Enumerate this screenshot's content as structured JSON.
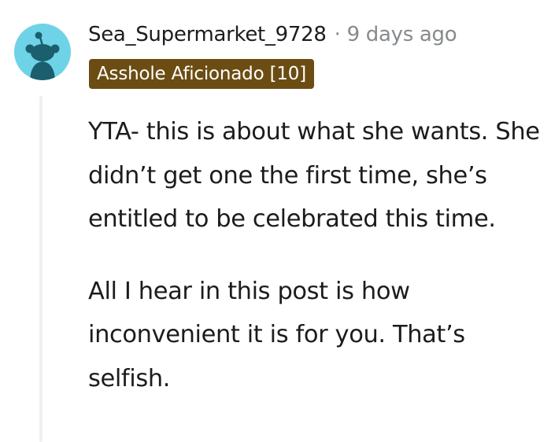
{
  "comment": {
    "username": "Sea_Supermarket_9728",
    "separator": "·",
    "timestamp": "9 days ago",
    "flair": "Asshole Aficionado [10]",
    "paragraphs": [
      "YTA- this is about what she wants. She didn’t get one the first time, she’s entitled to be celebrated this time.",
      "All I hear in this post is how inconvenient it is for you. That’s selfish."
    ]
  },
  "colors": {
    "avatar_bg": "#6fd3e8",
    "avatar_figure": "#1b5e6e",
    "flair_bg": "#6b4c12",
    "flair_text": "#ffffff",
    "meta_text": "#878a8c",
    "body_text": "#1c1c1c",
    "thread_line": "#edeff1"
  },
  "icons": {
    "avatar": "reddit-snoo-avatar-icon"
  }
}
